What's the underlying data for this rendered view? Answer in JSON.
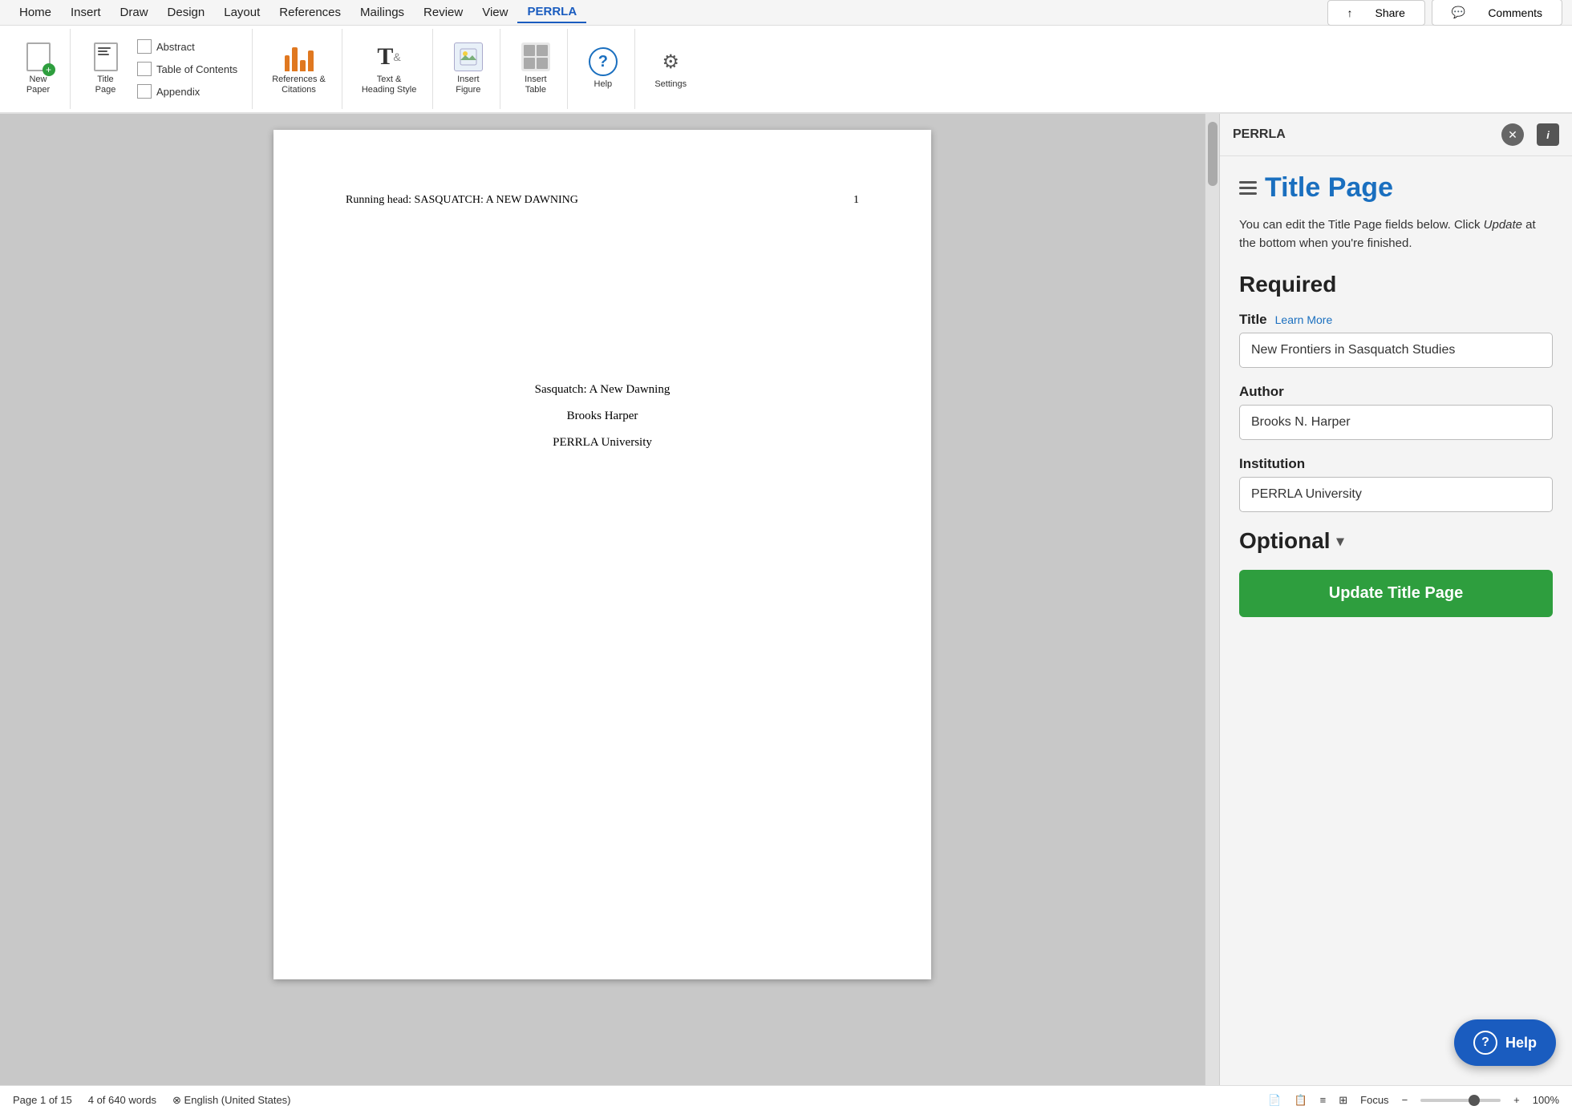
{
  "menubar": {
    "items": [
      "Home",
      "Insert",
      "Draw",
      "Design",
      "Layout",
      "References",
      "Mailings",
      "Review",
      "View",
      "PERRLA"
    ],
    "active": "PERRLA",
    "share_label": "Share",
    "comments_label": "Comments"
  },
  "ribbon": {
    "new_paper_label": "New\nPaper",
    "title_page_label": "Title\nPage",
    "abstract_label": "Abstract",
    "toc_label": "Table of Contents",
    "appendix_label": "Appendix",
    "refs_label": "References &\nCitations",
    "text_heading_label": "Text &\nHeading Style",
    "insert_figure_label": "Insert\nFigure",
    "insert_table_label": "Insert\nTable",
    "help_label": "Help",
    "settings_label": "Settings"
  },
  "document": {
    "running_head": "Running head: SASQUATCH: A NEW DAWNING",
    "page_number": "1",
    "title": "Sasquatch: A New Dawning",
    "author": "Brooks Harper",
    "institution": "PERRLA University"
  },
  "panel": {
    "header_title": "PERRLA",
    "section_title": "Title Page",
    "description_before_em": "You can edit the Title Page fields below. Click ",
    "description_em": "Update",
    "description_after_em": " at the bottom when you're finished.",
    "required_heading": "Required",
    "title_label": "Title",
    "learn_more_label": "Learn More",
    "title_value": "New Frontiers in Sasquatch Studies",
    "author_label": "Author",
    "author_value": "Brooks N. Harper",
    "institution_label": "Institution",
    "institution_value": "PERRLA University",
    "optional_label": "Optional",
    "update_btn_label": "Update Title Page",
    "help_btn_label": "Help"
  },
  "statusbar": {
    "page_info": "Page 1 of 15",
    "word_count": "4 of 640 words",
    "language": "English (United States)",
    "focus_label": "Focus",
    "zoom_level": "100%",
    "zoom_minus": "−",
    "zoom_plus": "+"
  }
}
